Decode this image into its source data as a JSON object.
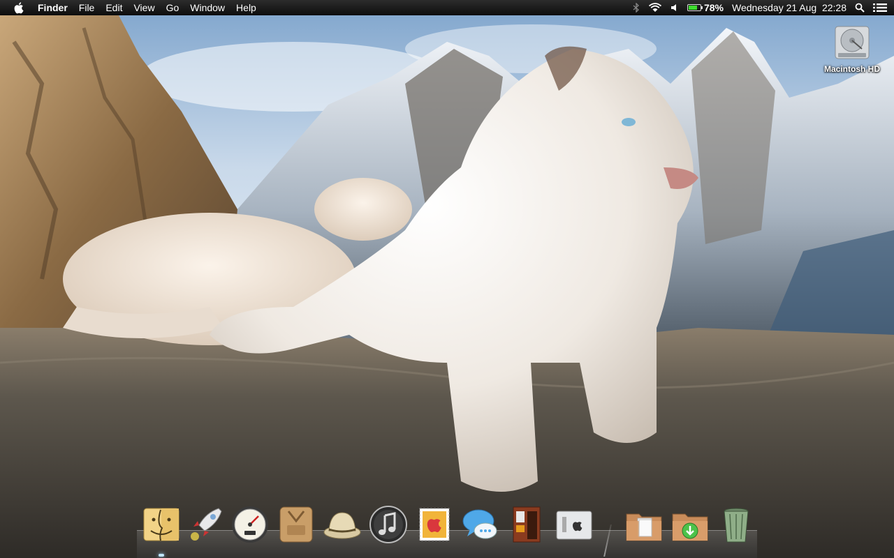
{
  "menubar": {
    "app_name": "Finder",
    "items": [
      "File",
      "Edit",
      "View",
      "Go",
      "Window",
      "Help"
    ],
    "battery_percent": "78%",
    "battery_level": 0.78,
    "clock": "Wednesday 21 Aug  22:28",
    "icons": [
      "apple-icon",
      "bluetooth-icon",
      "wifi-icon",
      "volume-icon",
      "battery-icon",
      "spotlight-icon",
      "notification-center-icon"
    ]
  },
  "desktop": {
    "icons": [
      {
        "label": "Macintosh HD",
        "icon": "hard-drive-icon"
      }
    ]
  },
  "dock": {
    "apps": [
      "finder-icon",
      "launchpad-icon",
      "dashboard-icon",
      "app-store-icon",
      "safari-icon",
      "itunes-icon",
      "mail-icon",
      "messages-icon",
      "photo-booth-icon",
      "system-preferences-icon"
    ],
    "stacks": [
      "documents-folder-icon",
      "downloads-folder-icon",
      "trash-icon"
    ]
  },
  "colors": {
    "menubar_bg": "#111111",
    "battery_fill": "#3ddc2e",
    "text": "#ffffff"
  }
}
